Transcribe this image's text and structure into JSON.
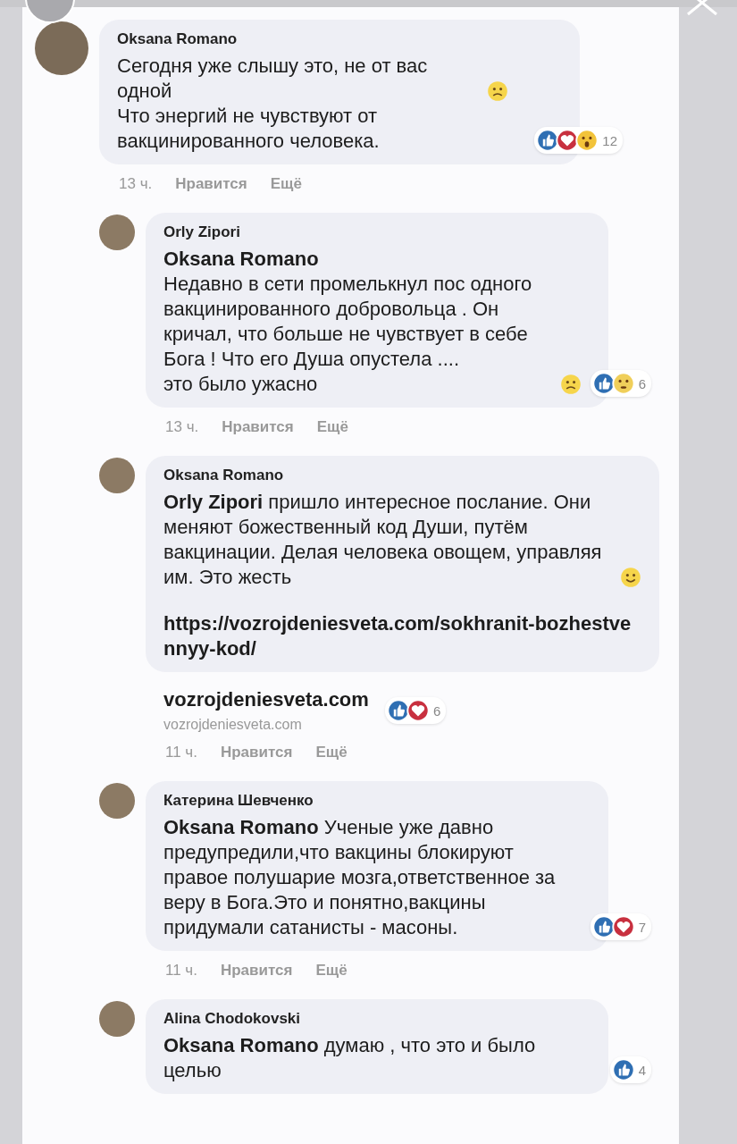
{
  "comments": [
    {
      "author": "Oksana Romano",
      "paragraphs": [
        {
          "text": "Сегодня уже слышу это, не от вас одной",
          "emoji": {
            "kind": "sad"
          }
        },
        {
          "text": "Что энергий не чувствуют от вакцинированного человека."
        }
      ],
      "reactions": [
        {
          "kind": "like"
        },
        {
          "kind": "love"
        },
        {
          "kind": "wow"
        }
      ],
      "count": "12",
      "time": "13 ч.",
      "actions": [
        "Нравится",
        "Ещё"
      ],
      "children": [
        {
          "author": "Orly Zipori",
          "paragraphs": [
            {
              "text": "**Oksana Romano**\nНедавно в сети промелькнул пос одного вакцинированного добровольца . Он кричал, что больше не чувствует в себе Бога ! Что его Душа опустела ....\nэто было ужасно",
              "emoji": {
                "kind": "sad"
              }
            }
          ],
          "reactions": [
            {
              "kind": "like"
            },
            {
              "kind": "sad"
            }
          ],
          "count": "6",
          "time": "13 ч.",
          "actions": [
            "Нравится",
            "Ещё"
          ]
        },
        {
          "author": "Oksana Romano",
          "paragraphs": [
            {
              "text": "**Orly Zipori** пришло интересное послание. Они меняют божественный код Души, путём вакцинации. Делая человека овощем, управляя им. Это жесть",
              "emoji": {
                "kind": "smile"
              }
            }
          ],
          "link": "https://vozrojdeniesveta.com/sokhranit-bozhestvennyy-kod/",
          "preview": {
            "title": "vozrojdeniesveta.com",
            "domain": "vozrojdeniesveta.com"
          },
          "reactions": [
            {
              "kind": "like"
            },
            {
              "kind": "love"
            }
          ],
          "count": "6",
          "time": "11 ч.",
          "actions": [
            "Нравится",
            "Ещё"
          ]
        },
        {
          "author": "Катерина Шевченко",
          "paragraphs": [
            {
              "text": "**Oksana Romano** Ученые уже давно предупредили,что вакцины блокируют правое полушарие мозга,ответственное за веру в Бога.Это и понятно,вакцины придумали сатанисты - масоны."
            }
          ],
          "reactions": [
            {
              "kind": "like"
            },
            {
              "kind": "love"
            }
          ],
          "count": "7",
          "time": "11 ч.",
          "actions": [
            "Нравится",
            "Ещё"
          ]
        },
        {
          "author": "Alina Chodokovski",
          "paragraphs": [
            {
              "text": "**Oksana Romano** думаю , что это и было целью"
            }
          ],
          "reactions": [
            {
              "kind": "like"
            }
          ],
          "count": "4"
        }
      ]
    }
  ]
}
